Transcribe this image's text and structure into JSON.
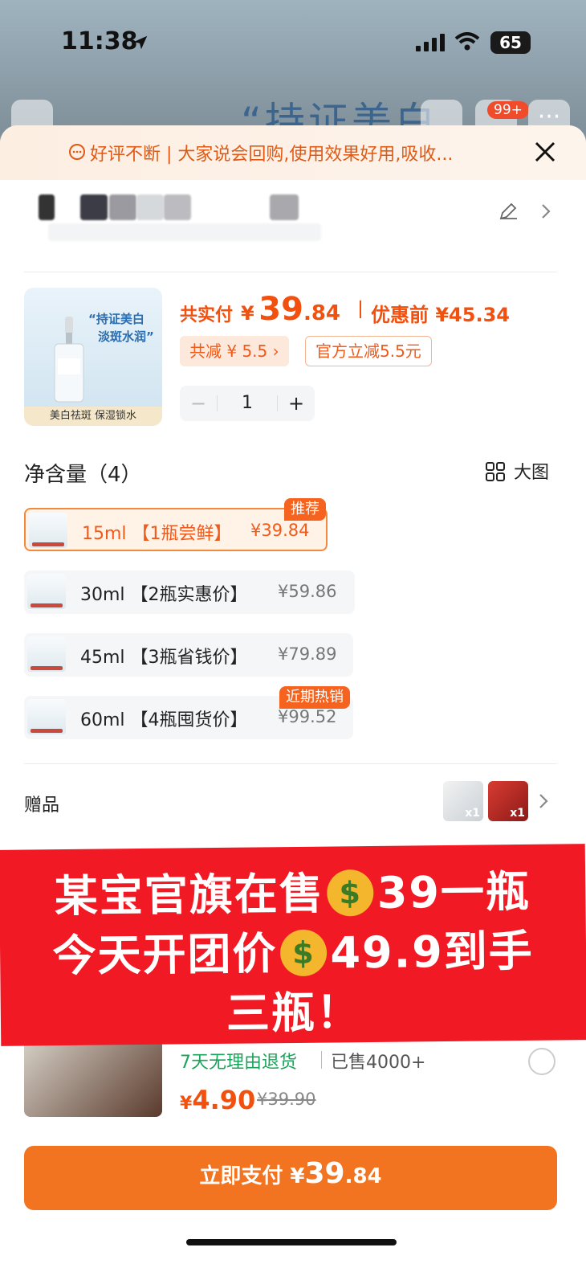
{
  "status": {
    "time": "11:38",
    "battery": "65"
  },
  "background": {
    "title_fragment": "“持证美白",
    "cart_badge": "99+"
  },
  "review_bar": {
    "text": "好评不断 | 大家说会回购,使用效果好用,吸收..."
  },
  "product": {
    "thumb_line1": "“持证美白",
    "thumb_line2": "淡斑水润”",
    "thumb_caption": "美白祛斑  保湿锁水",
    "total_label": "共实付",
    "price_yen": "¥",
    "price_int": "39",
    "price_dec": ".84",
    "before_label": "优惠前 ¥45.34",
    "discount_chip": "共减 ¥ 5.5 ›",
    "official_chip": "官方立减5.5元",
    "quantity": "1",
    "minus": "−",
    "plus": "+"
  },
  "spec": {
    "title": "净含量（4）",
    "big_image": "大图",
    "options": [
      {
        "label": "15ml 【1瓶尝鲜】",
        "price": "¥39.84",
        "badge": "推荐",
        "selected": true
      },
      {
        "label": "30ml 【2瓶实惠价】",
        "price": "¥59.86",
        "badge": "",
        "selected": false
      },
      {
        "label": "45ml 【3瓶省钱价】",
        "price": "¥79.89",
        "badge": "",
        "selected": false
      },
      {
        "label": "60ml 【4瓶囤货价】",
        "price": "¥99.52",
        "badge": "近期热销",
        "selected": false
      }
    ]
  },
  "gift": {
    "label": "赠品",
    "qty1": "x1",
    "qty2": "x1"
  },
  "promo": {
    "line1_a": "某宝官旗在售",
    "line1_b": "39一瓶",
    "line2_a": "今天开团价",
    "line2_b": "49.9到手",
    "line3": "三瓶！"
  },
  "addon": {
    "return_text": "7天无理由退货",
    "sold_text": "已售4000+",
    "price_yen": "¥",
    "price_int": "4.90",
    "old_price": "¥39.90"
  },
  "pay": {
    "label": "立即支付 ¥",
    "int": "39",
    "dec": ".84"
  },
  "colors": {
    "accent": "#f2500e",
    "button": "#f37420",
    "banner": "#f11a24"
  }
}
